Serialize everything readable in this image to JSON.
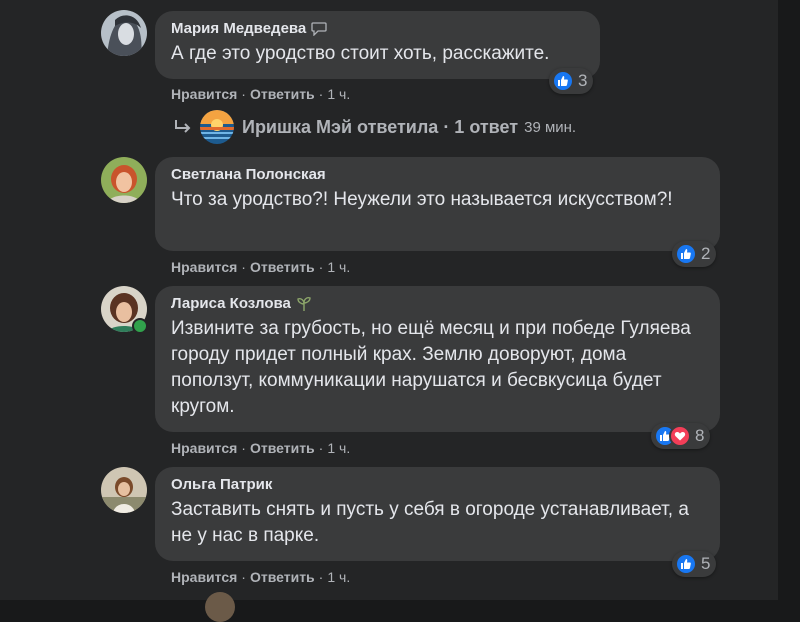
{
  "comments": [
    {
      "author": "Мария Медведева",
      "text": "А где это уродство стоит хоть, расскажите.",
      "reactions": "3",
      "like": "Нравится",
      "reply": "Ответить",
      "time": "1 ч.",
      "reply_thread": {
        "text": "Иришка Мэй ответила · 1 ответ",
        "time": "39 мин."
      }
    },
    {
      "author": "Светлана Полонская",
      "text": "Что за уродство?! Неужели это называется искусством?!",
      "reactions": "2",
      "like": "Нравится",
      "reply": "Ответить",
      "time": "1 ч."
    },
    {
      "author": "Лариса Козлова",
      "text": "Извините за грубость, но ещё месяц и при победе Гуляева городу придет полный крах. Землю доворуют, дома поползут, коммуникации нарушатся и бесвкусица будет кругом.",
      "reactions": "8",
      "like": "Нравится",
      "reply": "Ответить",
      "time": "1 ч."
    },
    {
      "author": "Ольга Патрик",
      "text": "Заставить снять и пусть у себя в огороде устанавливает, а не у нас в парке.",
      "reactions": "5",
      "like": "Нравится",
      "reply": "Ответить",
      "time": "1 ч."
    }
  ],
  "separator": "·",
  "colors": {
    "like": "#1877f2",
    "love": "#f33e58",
    "online": "#31a24c",
    "bubble": "#3a3b3c",
    "background": "#242526"
  }
}
